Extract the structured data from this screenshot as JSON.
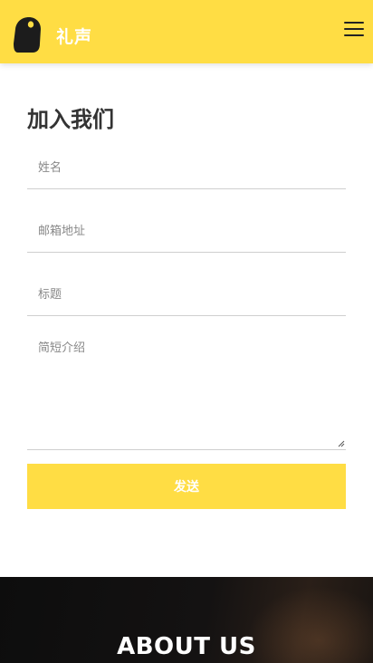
{
  "header": {
    "brand": "礼声",
    "logo_icon": "toucan-logo-icon",
    "menu_icon": "hamburger-menu-icon",
    "bg_color": "#ffdd44"
  },
  "form": {
    "title": "加入我们",
    "name_placeholder": "姓名",
    "email_placeholder": "邮箱地址",
    "subject_placeholder": "标题",
    "intro_placeholder": "简短介绍",
    "submit_label": "发送"
  },
  "about": {
    "heading": "ABOUT US"
  }
}
